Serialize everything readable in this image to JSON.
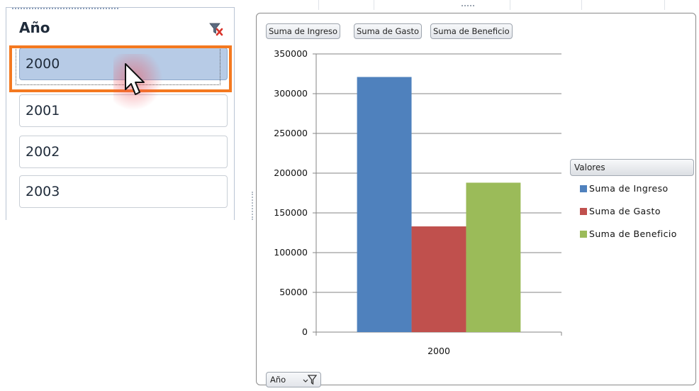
{
  "slicer": {
    "title": "Año",
    "clear_filter_icon": "clear-filter-icon",
    "items": [
      {
        "label": "2000",
        "selected": true
      },
      {
        "label": "2001",
        "selected": false
      },
      {
        "label": "2002",
        "selected": false
      },
      {
        "label": "2003",
        "selected": false
      }
    ],
    "highlight_color": "#F47920"
  },
  "chart": {
    "value_buttons": [
      "Suma de Ingreso",
      "Suma de Gasto",
      "Suma de Beneficio"
    ],
    "axis_filter_button": "Año",
    "axis_filter_icon": "filter-dropdown-icon",
    "legend_header": "Valores"
  },
  "chart_data": {
    "type": "bar",
    "categories": [
      "2000"
    ],
    "series": [
      {
        "name": "Suma de Ingreso",
        "values": [
          321000
        ],
        "color": "#4F81BD"
      },
      {
        "name": "Suma de Gasto",
        "values": [
          133000
        ],
        "color": "#C0504D"
      },
      {
        "name": "Suma de Beneficio",
        "values": [
          188000
        ],
        "color": "#9BBB59"
      }
    ],
    "yticks": [
      "0",
      "50000",
      "100000",
      "150000",
      "200000",
      "250000",
      "300000",
      "350000"
    ],
    "ylim": [
      0,
      350000
    ],
    "title": "",
    "xlabel": "",
    "ylabel": "",
    "grid": true,
    "legend_position": "right"
  }
}
